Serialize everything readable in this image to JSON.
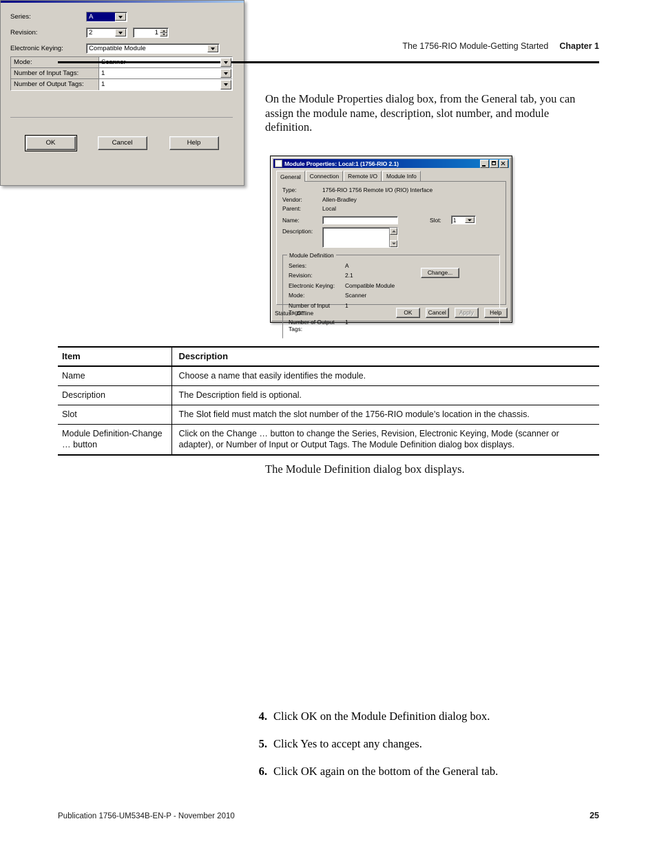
{
  "header": {
    "title": "The 1756-RIO Module-Getting Started",
    "chapter": "Chapter 1"
  },
  "intro_paragraph": "On the Module Properties dialog box, from the General tab, you can assign the module name, description, slot number, and module definition.",
  "module_properties_dialog": {
    "title": "Module Properties: Local:1 (1756-RIO 2.1)",
    "titlebar_buttons": [
      "minimize",
      "maximize",
      "close"
    ],
    "tabs": [
      {
        "label": "General",
        "active": true
      },
      {
        "label": "Connection",
        "active": false
      },
      {
        "label": "Remote I/O",
        "active": false
      },
      {
        "label": "Module Info",
        "active": false
      }
    ],
    "fields": {
      "type_label": "Type:",
      "type_value": "1756-RIO 1756 Remote I/O (RIO) Interface",
      "vendor_label": "Vendor:",
      "vendor_value": "Allen-Bradley",
      "parent_label": "Parent:",
      "parent_value": "Local",
      "name_label": "Name:",
      "name_value": "",
      "description_label": "Description:",
      "description_value": "",
      "slot_label": "Slot:",
      "slot_value": "1"
    },
    "module_definition": {
      "group_title": "Module Definition",
      "change_button": "Change...",
      "rows": [
        {
          "label": "Series:",
          "value": "A"
        },
        {
          "label": "Revision:",
          "value": "2.1"
        },
        {
          "label": "Electronic Keying:",
          "value": "Compatible Module"
        },
        {
          "label": "Mode:",
          "value": "Scanner"
        },
        {
          "label": "Number of Input Tags:",
          "value": "1"
        },
        {
          "label": "Number of Output Tags:",
          "value": "1"
        }
      ]
    },
    "status": {
      "label": "Status:",
      "value": "Offline"
    },
    "buttons": {
      "ok": "OK",
      "cancel": "Cancel",
      "apply": "Apply",
      "help": "Help"
    }
  },
  "table": {
    "headers": [
      "Item",
      "Description"
    ],
    "rows": [
      {
        "item": "Name",
        "description": "Choose a name that easily identifies the module."
      },
      {
        "item": "Description",
        "description": "The Description field is optional."
      },
      {
        "item": "Slot",
        "description": "The Slot field must match the slot number of the 1756-RIO module’s location in the chassis."
      },
      {
        "item": "Module Definition-Change … button",
        "description": "Click on the Change … button to change the Series, Revision, Electronic Keying, Mode (scanner or adapter), or Number of Input or Output Tags. The Module Definition dialog box displays."
      }
    ]
  },
  "module_def_caption": "The Module Definition dialog box displays.",
  "module_definition_dialog": {
    "series_label": "Series:",
    "series_value": "A",
    "revision_label": "Revision:",
    "revision_major": "2",
    "revision_minor": "1",
    "electronic_keying_label": "Electronic Keying:",
    "electronic_keying_value": "Compatible Module",
    "grid_rows": [
      {
        "label": "Mode:",
        "value": "Scanner"
      },
      {
        "label": "Number of Input Tags:",
        "value": "1"
      },
      {
        "label": "Number of Output Tags:",
        "value": "1"
      }
    ],
    "buttons": {
      "ok": "OK",
      "cancel": "Cancel",
      "help": "Help"
    }
  },
  "steps": [
    {
      "num": "4.",
      "text": "Click OK on the Module Definition dialog box."
    },
    {
      "num": "5.",
      "text": "Click Yes to accept any changes."
    },
    {
      "num": "6.",
      "text": "Click OK again on the bottom of the General tab."
    }
  ],
  "footer": {
    "publication": "Publication 1756-UM534B-EN-P - November 2010",
    "page_number": "25"
  }
}
